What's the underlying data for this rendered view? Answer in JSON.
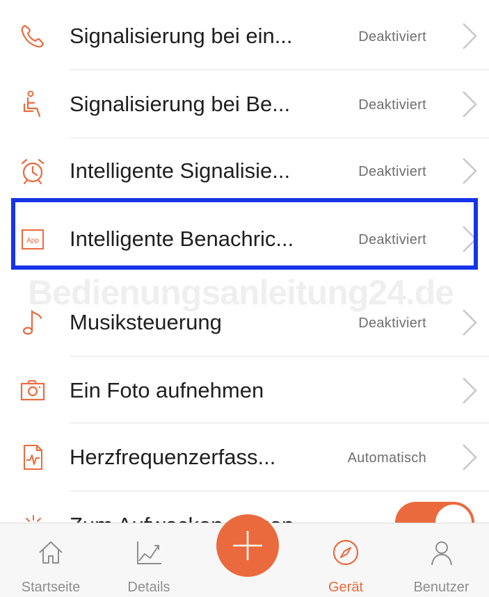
{
  "colors": {
    "accent": "#ea6a3d",
    "highlight": "#1734e6"
  },
  "rows": [
    {
      "icon": "phone-icon",
      "label": "Signalisierung bei ein...",
      "value": "Deaktiviert"
    },
    {
      "icon": "seat-icon",
      "label": "Signalisierung bei Be...",
      "value": "Deaktiviert"
    },
    {
      "icon": "alarm-clock-icon",
      "label": "Intelligente Signalisie...",
      "value": "Deaktiviert"
    },
    {
      "icon": "app-icon",
      "label": "Intelligente Benachric...",
      "value": "Deaktiviert",
      "app_text": "App"
    },
    {
      "icon": "music-note-icon",
      "label": "Musiksteuerung",
      "value": "Deaktiviert"
    },
    {
      "icon": "camera-icon",
      "label": "Ein Foto aufnehmen",
      "value": ""
    },
    {
      "icon": "heart-rate-icon",
      "label": "Herzfrequenzerfass...",
      "value": "Automatisch"
    }
  ],
  "partial_row": {
    "label": "Zum Aufwecken neigen",
    "toggle_on": true
  },
  "watermark": "Bedienungsanleitung24.de",
  "tabs": [
    {
      "icon": "home-icon",
      "label": "Startseite"
    },
    {
      "icon": "chart-icon",
      "label": "Details"
    },
    {
      "icon": "compass-icon",
      "label": "Gerät",
      "active": true
    },
    {
      "icon": "user-icon",
      "label": "Benutzer"
    }
  ]
}
